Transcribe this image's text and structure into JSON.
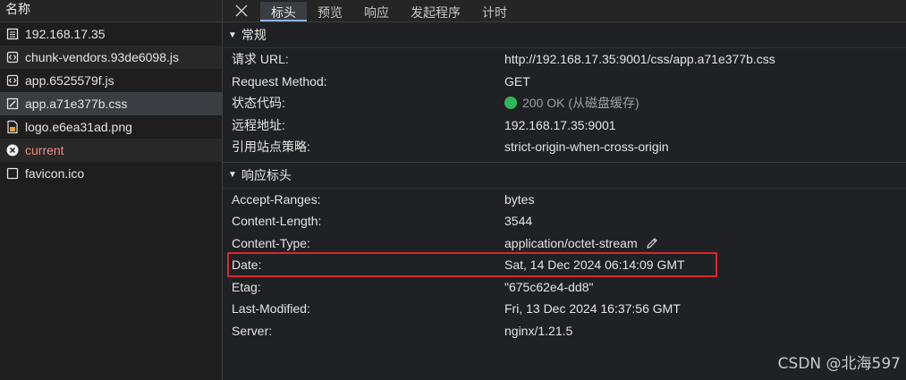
{
  "left_panel": {
    "header": "名称",
    "files": [
      {
        "name": "192.168.17.35",
        "icon": "document-icon",
        "state": "normal"
      },
      {
        "name": "chunk-vendors.93de6098.js",
        "icon": "script-icon",
        "state": "normal"
      },
      {
        "name": "app.6525579f.js",
        "icon": "script-icon",
        "state": "normal"
      },
      {
        "name": "app.a71e377b.css",
        "icon": "stylesheet-icon",
        "state": "selected"
      },
      {
        "name": "logo.e6ea31ad.png",
        "icon": "image-icon",
        "state": "normal"
      },
      {
        "name": "current",
        "icon": "error-icon",
        "state": "error"
      },
      {
        "name": "favicon.ico",
        "icon": "blank-file-icon",
        "state": "normal"
      }
    ]
  },
  "tabs": [
    "标头",
    "预览",
    "响应",
    "发起程序",
    "计时"
  ],
  "active_tab": "标头",
  "general": {
    "title": "常规",
    "rows": [
      {
        "key": "请求 URL:",
        "value": "http://192.168.17.35:9001/css/app.a71e377b.css"
      },
      {
        "key": "Request Method:",
        "value": "GET"
      },
      {
        "key": "状态代码:",
        "value": "200 OK (从磁盘缓存)"
      },
      {
        "key": "远程地址:",
        "value": "192.168.17.35:9001"
      },
      {
        "key": "引用站点策略:",
        "value": "strict-origin-when-cross-origin"
      }
    ]
  },
  "response_headers": {
    "title": "响应标头",
    "rows": [
      {
        "key": "Accept-Ranges:",
        "value": "bytes"
      },
      {
        "key": "Content-Length:",
        "value": "3544"
      },
      {
        "key": "Content-Type:",
        "value": "application/octet-stream"
      },
      {
        "key": "Date:",
        "value": "Sat, 14 Dec 2024 06:14:09 GMT"
      },
      {
        "key": "Etag:",
        "value": "\"675c62e4-dd8\""
      },
      {
        "key": "Last-Modified:",
        "value": "Fri, 13 Dec 2024 16:37:56 GMT"
      },
      {
        "key": "Server:",
        "value": "nginx/1.21.5"
      }
    ]
  },
  "watermark": "CSDN @北海597",
  "colors": {
    "status_ok": "#2fb65a",
    "highlight_box": "#d9272e",
    "active_tab_underline": "#8ab4f8"
  }
}
